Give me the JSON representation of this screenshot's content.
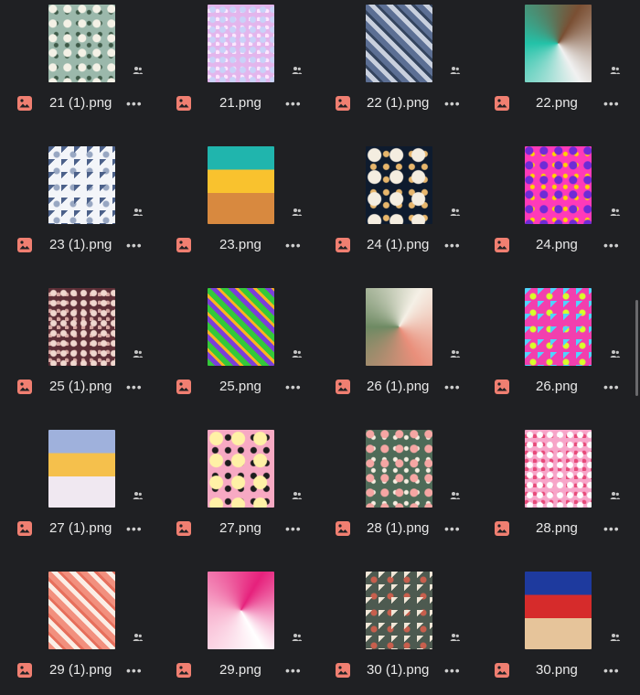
{
  "files": [
    {
      "name": "21 (1).png",
      "thumb": [
        "#9bb8ab",
        "#f4f1e6",
        "#3e5a48"
      ]
    },
    {
      "name": "21.png",
      "thumb": [
        "#e3b5ec",
        "#c9d2f8",
        "#fde7ff"
      ]
    },
    {
      "name": "22 (1).png",
      "thumb": [
        "#5c6f94",
        "#c9d0de",
        "#34445e"
      ]
    },
    {
      "name": "22.png",
      "thumb": [
        "#7a4f33",
        "#f1f1f1",
        "#23c2a8"
      ]
    },
    {
      "name": "23 (1).png",
      "thumb": [
        "#f3f5f9",
        "#4b6089",
        "#98a7c2"
      ]
    },
    {
      "name": "23.png",
      "thumb": [
        "#20b5ad",
        "#f9c22e",
        "#d8893f"
      ]
    },
    {
      "name": "24 (1).png",
      "thumb": [
        "#0e1b2e",
        "#f4ede0",
        "#e7b66c"
      ]
    },
    {
      "name": "24.png",
      "thumb": [
        "#ff3ab9",
        "#6f2bd6",
        "#ffd400"
      ]
    },
    {
      "name": "25 (1).png",
      "thumb": [
        "#5d2f37",
        "#f0d8cf",
        "#d6a6a1"
      ]
    },
    {
      "name": "25.png",
      "thumb": [
        "#34c93a",
        "#7b3fd8",
        "#ffb51f"
      ]
    },
    {
      "name": "26 (1).png",
      "thumb": [
        "#f5f0e6",
        "#e98f7b",
        "#6e8a63"
      ]
    },
    {
      "name": "26.png",
      "thumb": [
        "#f23fae",
        "#4fd4ff",
        "#d8ff2a"
      ]
    },
    {
      "name": "27 (1).png",
      "thumb": [
        "#9fb1dc",
        "#f5c04c",
        "#f0e8f1"
      ]
    },
    {
      "name": "27.png",
      "thumb": [
        "#f7a9c3",
        "#fff1a6",
        "#1d1d1d"
      ]
    },
    {
      "name": "28 (1).png",
      "thumb": [
        "#4e6b58",
        "#f5a6a3",
        "#f7eee1"
      ]
    },
    {
      "name": "28.png",
      "thumb": [
        "#f7a5c9",
        "#ffffff",
        "#e64a7a"
      ]
    },
    {
      "name": "29 (1).png",
      "thumb": [
        "#f2907e",
        "#fbeee6",
        "#e66f5c"
      ]
    },
    {
      "name": "29.png",
      "thumb": [
        "#e6217c",
        "#ffffff",
        "#f8b3cf"
      ]
    },
    {
      "name": "30 (1).png",
      "thumb": [
        "#4d5a50",
        "#f1e7d8",
        "#c85f4d"
      ]
    },
    {
      "name": "30.png",
      "thumb": [
        "#1e3a9e",
        "#d62b2b",
        "#e6c49a"
      ]
    }
  ],
  "icon_colors": {
    "file": "#f07f71",
    "shared": "#c5c5c5",
    "more": "#cfcfcf"
  },
  "icons": {
    "file": "image-file-icon",
    "shared": "shared-people-icon",
    "more": "more-options-icon"
  }
}
